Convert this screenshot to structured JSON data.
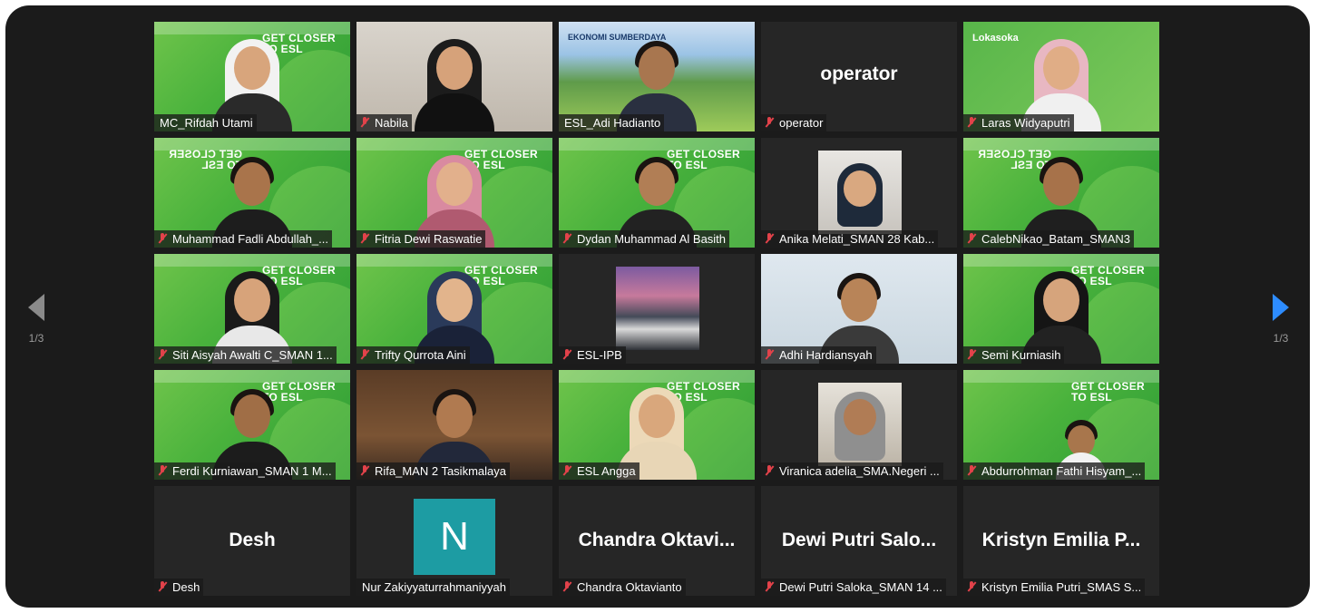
{
  "navigation": {
    "prev_page_indicator": "1/3",
    "next_page_indicator": "1/3"
  },
  "tiles": [
    {
      "name": "MC_Rifdah Utami",
      "muted": false,
      "video": true,
      "overlay": "GET CLOSER\nTO ESL"
    },
    {
      "name": "Nabila",
      "muted": true,
      "video": true
    },
    {
      "name": "ESL_Adi Hadianto",
      "muted": false,
      "video": true
    },
    {
      "name": "operator",
      "muted": true,
      "video": false,
      "display": "operator"
    },
    {
      "name": "Laras Widyaputri",
      "muted": true,
      "video": true,
      "overlay": "Lokasoka"
    },
    {
      "name": "Muhammad Fadli Abdullah_...",
      "muted": true,
      "video": true,
      "overlay": "GET CLOSER\nTO ESL"
    },
    {
      "name": "Fitria Dewi Raswatie",
      "muted": true,
      "video": true,
      "overlay": "GET CLOSER\nTO ESL"
    },
    {
      "name": "Dydan Muhammad Al Basith",
      "muted": true,
      "video": true,
      "overlay": "GET CLOSER\nTO ESL"
    },
    {
      "name": "Anika Melati_SMAN 28 Kab...",
      "muted": true,
      "video": true
    },
    {
      "name": "CalebNikao_Batam_SMAN3",
      "muted": true,
      "video": true,
      "overlay": "GET CLOSER\nTO ESL"
    },
    {
      "name": "Siti Aisyah Awalti C_SMAN 1...",
      "muted": true,
      "video": true,
      "overlay": "GET CLOSER\nTO ESL"
    },
    {
      "name": "Trifty Qurrota Aini",
      "muted": true,
      "video": true,
      "overlay": "GET CLOSER\nTO ESL"
    },
    {
      "name": "ESL-IPB",
      "muted": true,
      "video": true
    },
    {
      "name": "Adhi Hardiansyah",
      "muted": true,
      "video": true
    },
    {
      "name": "Semi Kurniasih",
      "muted": true,
      "video": true,
      "overlay": "GET CLOSER\nTO ESL"
    },
    {
      "name": "Ferdi Kurniawan_SMAN 1 M...",
      "muted": true,
      "video": true,
      "overlay": "GET CLOSER\nTO ESL"
    },
    {
      "name": "Rifa_MAN 2 Tasikmalaya",
      "muted": true,
      "video": true
    },
    {
      "name": "ESL Angga",
      "muted": true,
      "video": true,
      "overlay": "GET CLOSER\nTO ESL"
    },
    {
      "name": "Viranica adelia_SMA.Negeri ...",
      "muted": true,
      "video": true
    },
    {
      "name": "Abdurrohman Fathi Hisyam_...",
      "muted": true,
      "video": true,
      "overlay": "GET CLOSER\nTO ESL"
    },
    {
      "name": "Desh",
      "muted": true,
      "video": false,
      "display": "Desh"
    },
    {
      "name": "Nur Zakiyyaturrahmaniyyah",
      "muted": false,
      "video": false,
      "display": "N"
    },
    {
      "name": "Chandra Oktavianto",
      "muted": true,
      "video": false,
      "display": "Chandra  Oktavi..."
    },
    {
      "name": "Dewi Putri Saloka_SMAN 14 ...",
      "muted": true,
      "video": false,
      "display": "Dewi Putri Salo..."
    },
    {
      "name": "Kristyn Emilia Putri_SMAS S...",
      "muted": true,
      "video": false,
      "display": "Kristyn Emilia P..."
    }
  ]
}
